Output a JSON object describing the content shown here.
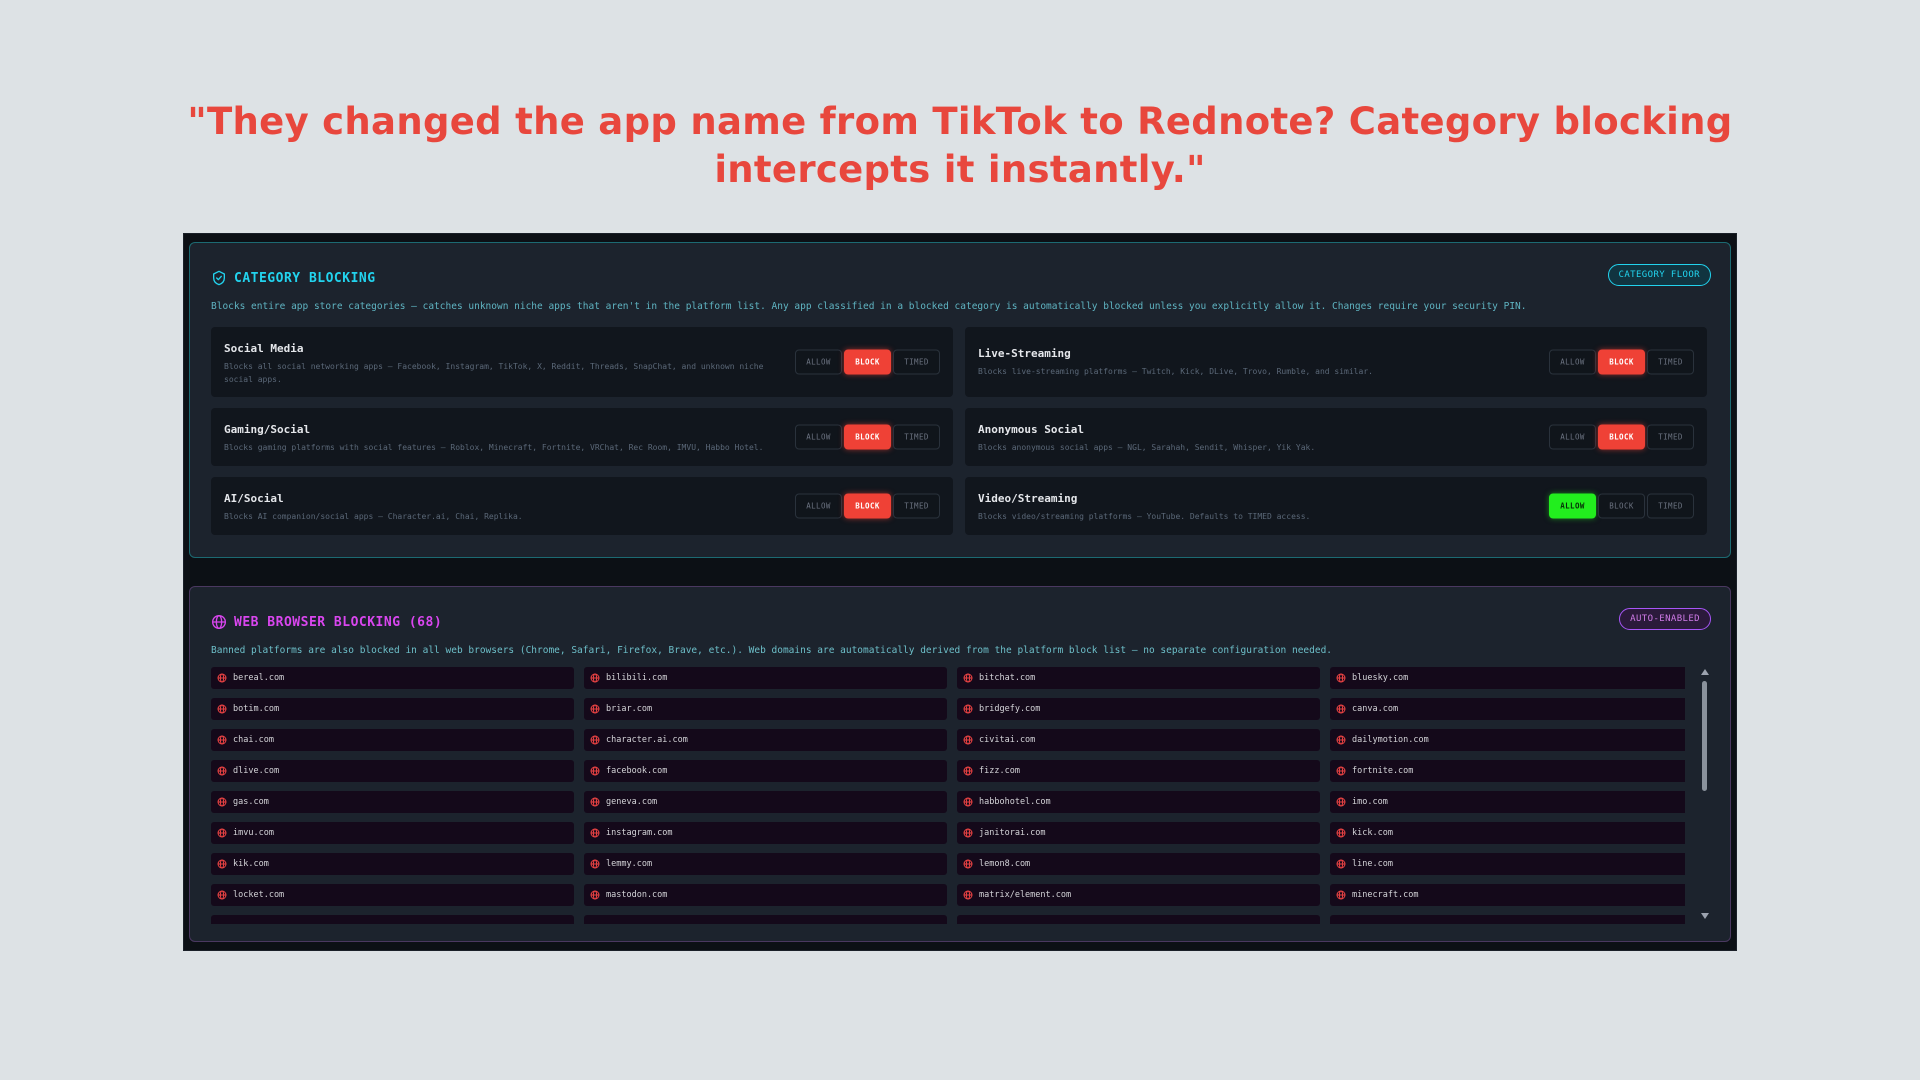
{
  "headline": {
    "line1": "\"They changed the app name from TikTok to Rednote? Category blocking",
    "line2": "intercepts it instantly.\""
  },
  "category_blocking": {
    "title": "CATEGORY BLOCKING",
    "icon": "shield-check-icon",
    "badge": "CATEGORY FLOOR",
    "description": "Blocks entire app store categories — catches unknown niche apps that aren't in the platform list. Any app classified in a blocked category is automatically blocked unless you explicitly allow it. Changes require your security PIN.",
    "button_labels": {
      "allow": "ALLOW",
      "block": "BLOCK",
      "timed": "TIMED"
    },
    "categories": [
      {
        "name": "Social Media",
        "description": "Blocks all social networking apps — Facebook, Instagram, TikTok, X, Reddit, Threads, SnapChat, and unknown niche social apps.",
        "state": "BLOCK"
      },
      {
        "name": "Live-Streaming",
        "description": "Blocks live-streaming platforms — Twitch, Kick, DLive, Trovo, Rumble, and similar.",
        "state": "BLOCK"
      },
      {
        "name": "Gaming/Social",
        "description": "Blocks gaming platforms with social features — Roblox, Minecraft, Fortnite, VRChat, Rec Room, IMVU, Habbo Hotel.",
        "state": "BLOCK"
      },
      {
        "name": "Anonymous Social",
        "description": "Blocks anonymous social apps — NGL, Sarahah, Sendit, Whisper, Yik Yak.",
        "state": "BLOCK"
      },
      {
        "name": "AI/Social",
        "description": "Blocks AI companion/social apps — Character.ai, Chai, Replika.",
        "state": "BLOCK"
      },
      {
        "name": "Video/Streaming",
        "description": "Blocks video/streaming platforms — YouTube. Defaults to TIMED access.",
        "state": "ALLOW"
      }
    ],
    "colors": {
      "accent": "#22d3ee",
      "block": "#ef4136",
      "allow": "#22ee1e"
    }
  },
  "web_blocking": {
    "title": "WEB BROWSER BLOCKING (68)",
    "icon": "globe-icon",
    "badge": "AUTO-ENABLED",
    "description": "Banned platforms are also blocked in all web browsers (Chrome, Safari, Firefox, Brave, etc.). Web domains are automatically derived from the platform block list — no separate configuration needed.",
    "domains": [
      "bereal.com",
      "bilibili.com",
      "bitchat.com",
      "bluesky.com",
      "botim.com",
      "briar.com",
      "bridgefy.com",
      "canva.com",
      "chai.com",
      "character.ai.com",
      "civitai.com",
      "dailymotion.com",
      "dlive.com",
      "facebook.com",
      "fizz.com",
      "fortnite.com",
      "gas.com",
      "geneva.com",
      "habbohotel.com",
      "imo.com",
      "imvu.com",
      "instagram.com",
      "janitorai.com",
      "kick.com",
      "kik.com",
      "lemmy.com",
      "lemon8.com",
      "line.com",
      "locket.com",
      "mastodon.com",
      "matrix/element.com",
      "minecraft.com",
      "",
      "",
      "",
      ""
    ],
    "colors": {
      "accent": "#d946ef",
      "globe": "#ef4444"
    }
  }
}
